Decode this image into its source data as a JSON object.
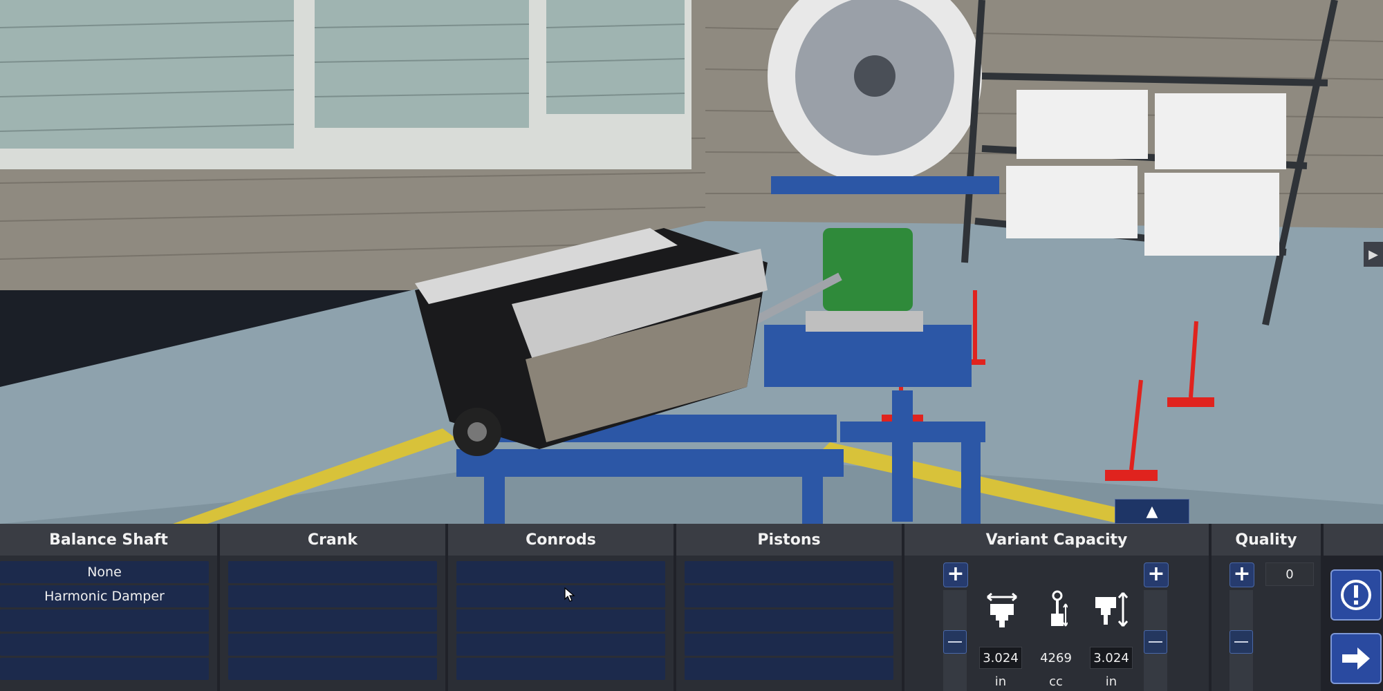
{
  "scene": {
    "description_icon": "engine-test-bench-3d-scene"
  },
  "columns": {
    "balance_shaft": {
      "title": "Balance Shaft",
      "items": [
        "None",
        "Harmonic Damper"
      ]
    },
    "crank": {
      "title": "Crank"
    },
    "conrods": {
      "title": "Conrods"
    },
    "pistons": {
      "title": "Pistons"
    },
    "variant_capacity": {
      "title": "Variant Capacity",
      "bore_value": "3.024",
      "bore_unit": "in",
      "capacity_value": "4269",
      "capacity_unit": "cc",
      "stroke_value": "3.024",
      "stroke_unit": "in",
      "bore_icon": "bore-icon",
      "capacity_icon": "displacement-icon",
      "stroke_icon": "stroke-icon"
    },
    "quality": {
      "title": "Quality",
      "value": "0"
    }
  },
  "buttons": {
    "plus": "+",
    "expand": "▲",
    "side": "▶"
  },
  "colors": {
    "panel_bg": "#2b2e35",
    "header_bg": "#3a3d44",
    "row_bg": "#1c2a4c",
    "accent": "#2a4aa0"
  }
}
